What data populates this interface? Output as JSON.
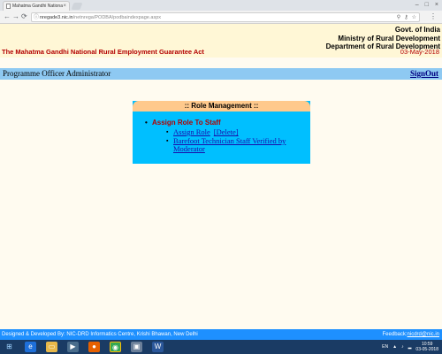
{
  "browser": {
    "tab_title": "Mahatma Gandhi Nationa",
    "url_host": "nregade3.nic.in",
    "url_path": "/netnrega/PODBA/podbaindexpage.aspx"
  },
  "header": {
    "gov_line1": "Govt. of India",
    "gov_line2": "Ministry of Rural Development",
    "gov_line3": "Department of Rural Development",
    "act_title": "The Mahatma Gandhi National Rural Employment Guarantee Act",
    "date": "03-May-2018"
  },
  "rolebar": {
    "user_role": "Programme Officer Administrator",
    "signout_label": "SignOut"
  },
  "panel": {
    "title": ":: Role Management ::",
    "section_label": "Assign Role To Staff",
    "assign_role_link": "Assign Role",
    "delete_link": "[Delete]",
    "barefoot_link": "Barefoot Technician Staff Verified by Moderator"
  },
  "footer": {
    "developed_by": "Designed & Developed By: NIC-DRD Informatics Centre, Krishi Bhawan, New Delhi",
    "feedback_label": "Feedback:",
    "feedback_email": "nicdrd@nic.in"
  },
  "taskbar": {
    "language": "EN",
    "time": "10:59",
    "date": "03-05-2018"
  },
  "colors": {
    "header_bg": "#fff7d6",
    "act_red": "#b30000",
    "rolebar_blue": "#8ec9f2",
    "panel_blue": "#00bfff",
    "panel_head_orange": "#ffc98c",
    "footer_blue": "#1e90ff"
  }
}
